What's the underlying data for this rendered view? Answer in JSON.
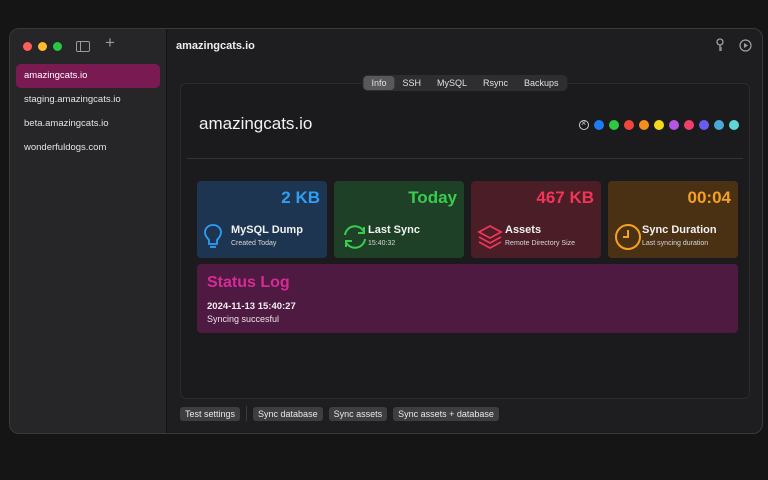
{
  "sidebar": {
    "sites": [
      {
        "label": "amazingcats.io",
        "active": true
      },
      {
        "label": "staging.amazingcats.io",
        "active": false
      },
      {
        "label": "beta.amazingcats.io",
        "active": false
      },
      {
        "label": "wonderfuldogs.com",
        "active": false
      }
    ]
  },
  "header": {
    "title": "amazingcats.io"
  },
  "tabs": [
    {
      "label": "Info",
      "active": true
    },
    {
      "label": "SSH",
      "active": false
    },
    {
      "label": "MySQL",
      "active": false
    },
    {
      "label": "Rsync",
      "active": false
    },
    {
      "label": "Backups",
      "active": false
    }
  ],
  "site": {
    "heading": "amazingcats.io",
    "color_tags": [
      "none",
      "#1e7cf2",
      "#2fc840",
      "#f2463b",
      "#f48f1f",
      "#f6d71c",
      "#b356e0",
      "#f03f6a",
      "#6a5cf0",
      "#4aa8d8",
      "#5fd6d6"
    ]
  },
  "stats": [
    {
      "value": "2 KB",
      "label": "MySQL Dump",
      "sub": "Created Today",
      "icon": "lightbulb-icon",
      "color": "#2f9ef5"
    },
    {
      "value": "Today",
      "label": "Last Sync",
      "sub": "15:40:32",
      "icon": "sync-icon",
      "color": "#39cc4f"
    },
    {
      "value": "467 KB",
      "label": "Assets",
      "sub": "Remote Directory Size",
      "icon": "layers-icon",
      "color": "#f23557"
    },
    {
      "value": "00:04",
      "label": "Sync Duration",
      "sub": "Last syncing duration",
      "icon": "clock-icon",
      "color": "#f7a021"
    }
  ],
  "status_log": {
    "title": "Status Log",
    "timestamp": "2024-11-13 15:40:27",
    "message": "Syncing succesful"
  },
  "actions": {
    "test": "Test settings",
    "sync_db": "Sync database",
    "sync_assets": "Sync assets",
    "sync_both": "Sync assets + database"
  }
}
